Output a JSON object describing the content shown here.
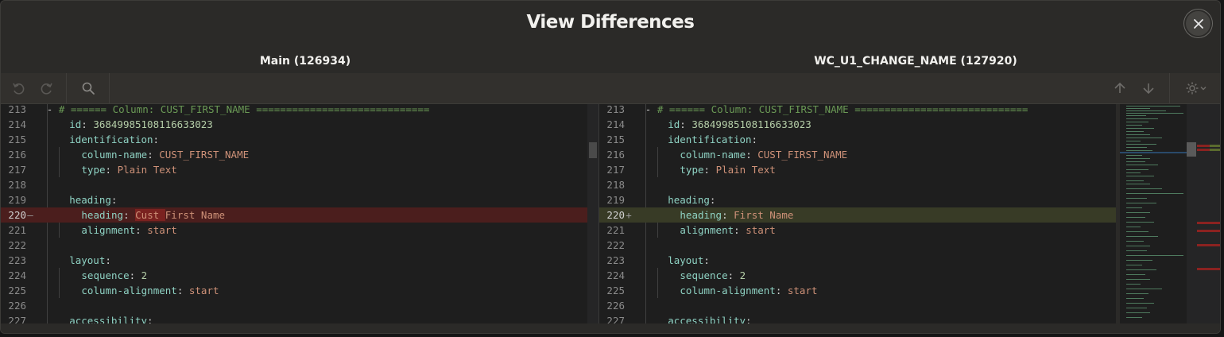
{
  "dialog": {
    "title": "View Differences",
    "close_icon": "close-icon"
  },
  "panes": {
    "left_title": "Main (126934)",
    "right_title": "WC_U1_CHANGE_NAME (127920)"
  },
  "toolbar": {
    "undo_icon": "undo-icon",
    "redo_icon": "redo-icon",
    "search_icon": "search-icon",
    "prev_diff_icon": "arrow-up-icon",
    "next_diff_icon": "arrow-down-icon",
    "settings_icon": "gear-icon"
  },
  "colors": {
    "deleted_line": "#4b1e1d",
    "deleted_word": "#7a2220",
    "added_line": "#383b26",
    "key": "#8fd3c4",
    "string": "#ce9178",
    "number": "#b5cea8",
    "comment": "#6a9955"
  },
  "left": {
    "lines": [
      {
        "num": "213",
        "marker": "",
        "tokens": [
          {
            "t": "- ",
            "c": "p"
          },
          {
            "t": "# ====== Column: CUST_FIRST_NAME =============================",
            "c": "c"
          }
        ]
      },
      {
        "num": "214",
        "marker": "",
        "tokens": [
          {
            "t": "id",
            "c": "k"
          },
          {
            "t": ": ",
            "c": "p"
          },
          {
            "t": "36849985108116633023",
            "c": "n"
          }
        ]
      },
      {
        "num": "215",
        "marker": "",
        "tokens": [
          {
            "t": "identification",
            "c": "k"
          },
          {
            "t": ":",
            "c": "p"
          }
        ]
      },
      {
        "num": "216",
        "marker": "",
        "tokens": [
          {
            "t": "column-name",
            "c": "k"
          },
          {
            "t": ": ",
            "c": "p"
          },
          {
            "t": "CUST_FIRST_NAME",
            "c": "s"
          }
        ]
      },
      {
        "num": "217",
        "marker": "",
        "tokens": [
          {
            "t": "type",
            "c": "k"
          },
          {
            "t": ": ",
            "c": "p"
          },
          {
            "t": "Plain Text",
            "c": "s"
          }
        ]
      },
      {
        "num": "218",
        "marker": "",
        "tokens": []
      },
      {
        "num": "219",
        "marker": "",
        "tokens": [
          {
            "t": "heading",
            "c": "k"
          },
          {
            "t": ":",
            "c": "p"
          }
        ]
      },
      {
        "num": "220",
        "marker": "—",
        "diff": "del",
        "tokens": [
          {
            "t": "heading",
            "c": "k"
          },
          {
            "t": ": ",
            "c": "p"
          },
          {
            "t": "Cust ",
            "c": "s",
            "hl": true
          },
          {
            "t": "First Name",
            "c": "s"
          }
        ]
      },
      {
        "num": "221",
        "marker": "",
        "tokens": [
          {
            "t": "alignment",
            "c": "k"
          },
          {
            "t": ": ",
            "c": "p"
          },
          {
            "t": "start",
            "c": "s"
          }
        ]
      },
      {
        "num": "222",
        "marker": "",
        "tokens": []
      },
      {
        "num": "223",
        "marker": "",
        "tokens": [
          {
            "t": "layout",
            "c": "k"
          },
          {
            "t": ":",
            "c": "p"
          }
        ]
      },
      {
        "num": "224",
        "marker": "",
        "tokens": [
          {
            "t": "sequence",
            "c": "k"
          },
          {
            "t": ": ",
            "c": "p"
          },
          {
            "t": "2",
            "c": "n"
          }
        ]
      },
      {
        "num": "225",
        "marker": "",
        "tokens": [
          {
            "t": "column-alignment",
            "c": "k"
          },
          {
            "t": ": ",
            "c": "p"
          },
          {
            "t": "start",
            "c": "s"
          }
        ]
      },
      {
        "num": "226",
        "marker": "",
        "tokens": []
      },
      {
        "num": "227",
        "marker": "",
        "tokens": [
          {
            "t": "accessibility",
            "c": "k"
          },
          {
            "t": ":",
            "c": "p"
          }
        ]
      }
    ]
  },
  "right": {
    "lines": [
      {
        "num": "213",
        "marker": "",
        "tokens": [
          {
            "t": "- ",
            "c": "p"
          },
          {
            "t": "# ====== Column: CUST_FIRST_NAME =============================",
            "c": "c"
          }
        ]
      },
      {
        "num": "214",
        "marker": "",
        "tokens": [
          {
            "t": "id",
            "c": "k"
          },
          {
            "t": ": ",
            "c": "p"
          },
          {
            "t": "36849985108116633023",
            "c": "n"
          }
        ]
      },
      {
        "num": "215",
        "marker": "",
        "tokens": [
          {
            "t": "identification",
            "c": "k"
          },
          {
            "t": ":",
            "c": "p"
          }
        ]
      },
      {
        "num": "216",
        "marker": "",
        "tokens": [
          {
            "t": "column-name",
            "c": "k"
          },
          {
            "t": ": ",
            "c": "p"
          },
          {
            "t": "CUST_FIRST_NAME",
            "c": "s"
          }
        ]
      },
      {
        "num": "217",
        "marker": "",
        "tokens": [
          {
            "t": "type",
            "c": "k"
          },
          {
            "t": ": ",
            "c": "p"
          },
          {
            "t": "Plain Text",
            "c": "s"
          }
        ]
      },
      {
        "num": "218",
        "marker": "",
        "tokens": []
      },
      {
        "num": "219",
        "marker": "",
        "tokens": [
          {
            "t": "heading",
            "c": "k"
          },
          {
            "t": ":",
            "c": "p"
          }
        ]
      },
      {
        "num": "220",
        "marker": "+",
        "diff": "add",
        "tokens": [
          {
            "t": "heading",
            "c": "k"
          },
          {
            "t": ": ",
            "c": "p"
          },
          {
            "t": "First Name",
            "c": "s"
          }
        ]
      },
      {
        "num": "221",
        "marker": "",
        "tokens": [
          {
            "t": "alignment",
            "c": "k"
          },
          {
            "t": ": ",
            "c": "p"
          },
          {
            "t": "start",
            "c": "s"
          }
        ]
      },
      {
        "num": "222",
        "marker": "",
        "tokens": []
      },
      {
        "num": "223",
        "marker": "",
        "tokens": [
          {
            "t": "layout",
            "c": "k"
          },
          {
            "t": ":",
            "c": "p"
          }
        ]
      },
      {
        "num": "224",
        "marker": "",
        "tokens": [
          {
            "t": "sequence",
            "c": "k"
          },
          {
            "t": ": ",
            "c": "p"
          },
          {
            "t": "2",
            "c": "n"
          }
        ]
      },
      {
        "num": "225",
        "marker": "",
        "tokens": [
          {
            "t": "column-alignment",
            "c": "k"
          },
          {
            "t": ": ",
            "c": "p"
          },
          {
            "t": "start",
            "c": "s"
          }
        ]
      },
      {
        "num": "226",
        "marker": "",
        "tokens": []
      },
      {
        "num": "227",
        "marker": "",
        "tokens": [
          {
            "t": "accessibility",
            "c": "k"
          },
          {
            "t": ":",
            "c": "p"
          }
        ]
      }
    ]
  }
}
